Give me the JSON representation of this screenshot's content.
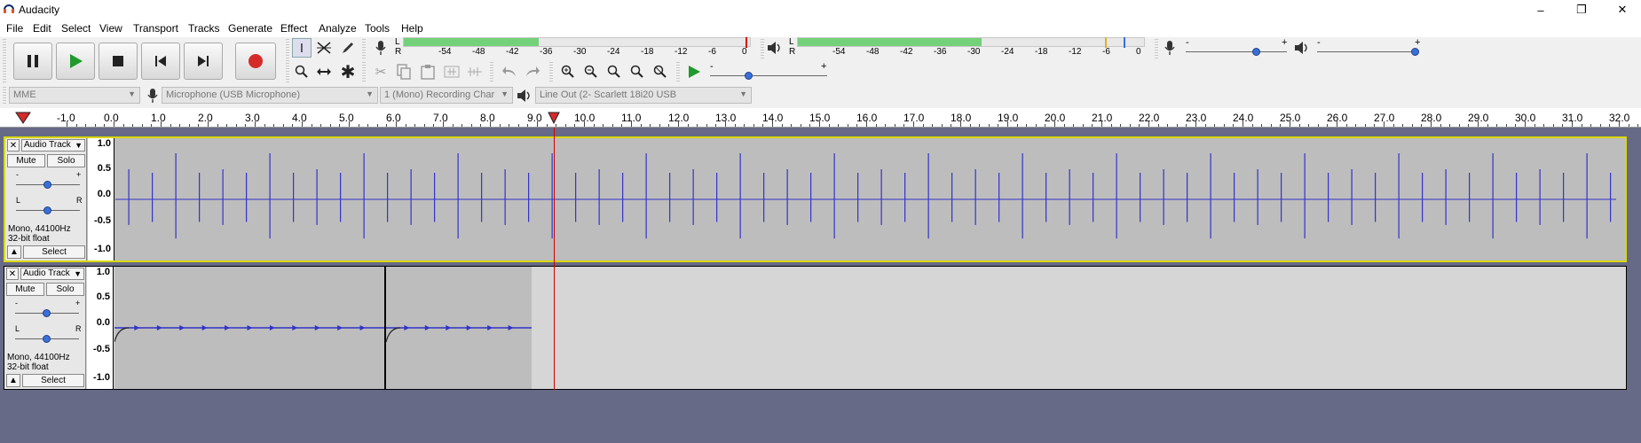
{
  "window": {
    "title": "Audacity",
    "minimize": "–",
    "restore": "❐",
    "close": "✕"
  },
  "menu": [
    "File",
    "Edit",
    "Select",
    "View",
    "Transport",
    "Tracks",
    "Generate",
    "Effect",
    "Analyze",
    "Tools",
    "Help"
  ],
  "transport": {
    "pause_icon": "pause-icon",
    "play_icon": "play-icon",
    "stop_icon": "stop-icon",
    "skip_start_icon": "skip-to-start-icon",
    "skip_end_icon": "skip-to-end-icon",
    "record_icon": "record-icon"
  },
  "meters": {
    "record_scale": [
      "-54",
      "-48",
      "-42",
      "-36",
      "-30",
      "-24",
      "-18",
      "-12",
      "-6",
      "0"
    ],
    "playback_scale": [
      "-54",
      "-48",
      "-42",
      "-36",
      "-30",
      "-24",
      "-18",
      "-12",
      "-6",
      "0"
    ],
    "record_lr": [
      "L",
      "R"
    ],
    "playback_lr": [
      "L",
      "R"
    ],
    "slider_minus": "-",
    "slider_plus": "+",
    "record_level": 0.39,
    "playback_level": 0.53
  },
  "mixer": {
    "input_volume": 0.72,
    "output_volume": 1.0
  },
  "device_bar": {
    "host": "MME",
    "input_device": "Microphone (USB Microphone)",
    "channels": "1 (Mono) Recording Char",
    "output_device": "Line Out (2- Scarlett 18i20 USB"
  },
  "ruler": {
    "labels": [
      "-1.0",
      "0.0",
      "1.0",
      "2.0",
      "3.0",
      "4.0",
      "5.0",
      "6.0",
      "7.0",
      "8.0",
      "9.0",
      "10.0",
      "11.0",
      "12.0",
      "13.0",
      "14.0",
      "15.0",
      "16.0",
      "17.0",
      "18.0",
      "19.0",
      "20.0",
      "21.0",
      "22.0",
      "23.0",
      "24.0",
      "25.0",
      "26.0",
      "27.0",
      "28.0",
      "29.0",
      "30.0",
      "31.0",
      "32.0"
    ],
    "playhead_seconds": 9.35
  },
  "tracks": [
    {
      "name": "Audio Track",
      "mute": "Mute",
      "solo": "Solo",
      "gain_minus": "-",
      "gain_plus": "+",
      "pan_left": "L",
      "pan_right": "R",
      "info_line1": "Mono, 44100Hz",
      "info_line2": "32-bit float",
      "select": "Select",
      "scale": [
        "1.0",
        "0.5",
        "0.0",
        "-0.5",
        "-1.0"
      ]
    },
    {
      "name": "Audio Track",
      "mute": "Mute",
      "solo": "Solo",
      "gain_minus": "-",
      "gain_plus": "+",
      "pan_left": "L",
      "pan_right": "R",
      "info_line1": "Mono, 44100Hz",
      "info_line2": "32-bit float",
      "select": "Select",
      "scale": [
        "1.0",
        "0.5",
        "0.0",
        "-0.5",
        "-1.0"
      ]
    }
  ],
  "colors": {
    "waveform": "#3232c8",
    "playhead": "#d00000",
    "meter_green": "#73d17a",
    "record_red": "#d62a2a"
  }
}
